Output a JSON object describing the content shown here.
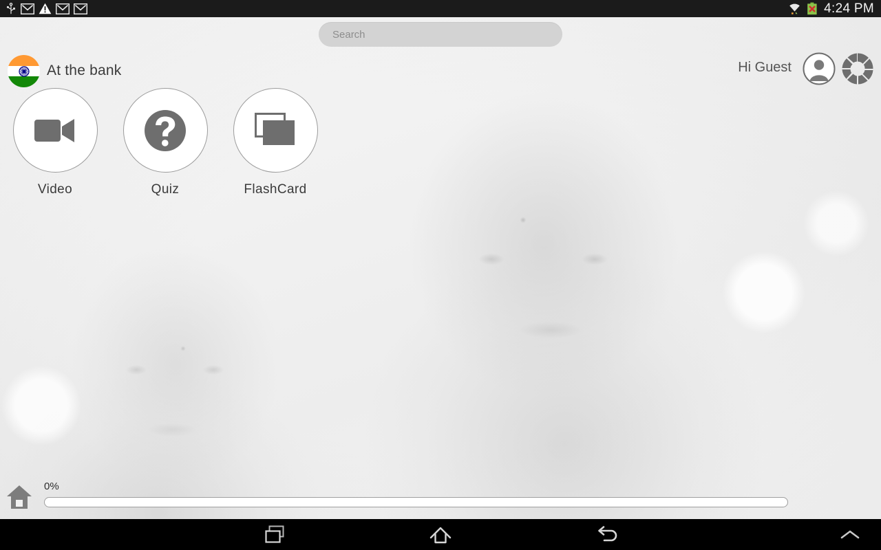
{
  "status_bar": {
    "icons": [
      "usb-icon",
      "gmail-icon",
      "warning-icon",
      "gmail-icon",
      "gmail-icon"
    ],
    "right_icons": [
      "wifi-icon",
      "battery-error-icon"
    ],
    "time": "4:24 PM",
    "background_color": "#1b1b1b"
  },
  "search": {
    "placeholder": "Search",
    "value": "",
    "background_color": "#d3d3d3"
  },
  "header": {
    "flag_icon": "india-flag-icon",
    "title": "At the bank",
    "greeting": "Hi Guest",
    "avatar_icon": "user-avatar-icon",
    "settings_icon": "settings-wheel-icon"
  },
  "tiles": [
    {
      "label": "Video",
      "icon": "video-camera-icon"
    },
    {
      "label": "Quiz",
      "icon": "question-mark-icon"
    },
    {
      "label": "FlashCard",
      "icon": "stacked-cards-icon"
    }
  ],
  "progress": {
    "home_icon": "home-icon",
    "percent_label": "0%",
    "percent_value": 0,
    "accent_color": "#5b9bd5"
  },
  "nav_bar": {
    "buttons": [
      {
        "name": "recents",
        "icon": "recents-icon"
      },
      {
        "name": "home",
        "icon": "home-outline-icon"
      },
      {
        "name": "back",
        "icon": "back-arrow-icon"
      },
      {
        "name": "expand",
        "icon": "chevron-up-icon"
      }
    ],
    "background_color": "#000000"
  },
  "theme": {
    "tile_icon_color": "#6e6e6e",
    "text_color": "#3a3a3a",
    "flag_saffron": "#ff9933",
    "flag_green": "#138808",
    "flag_chakra": "#000088"
  }
}
